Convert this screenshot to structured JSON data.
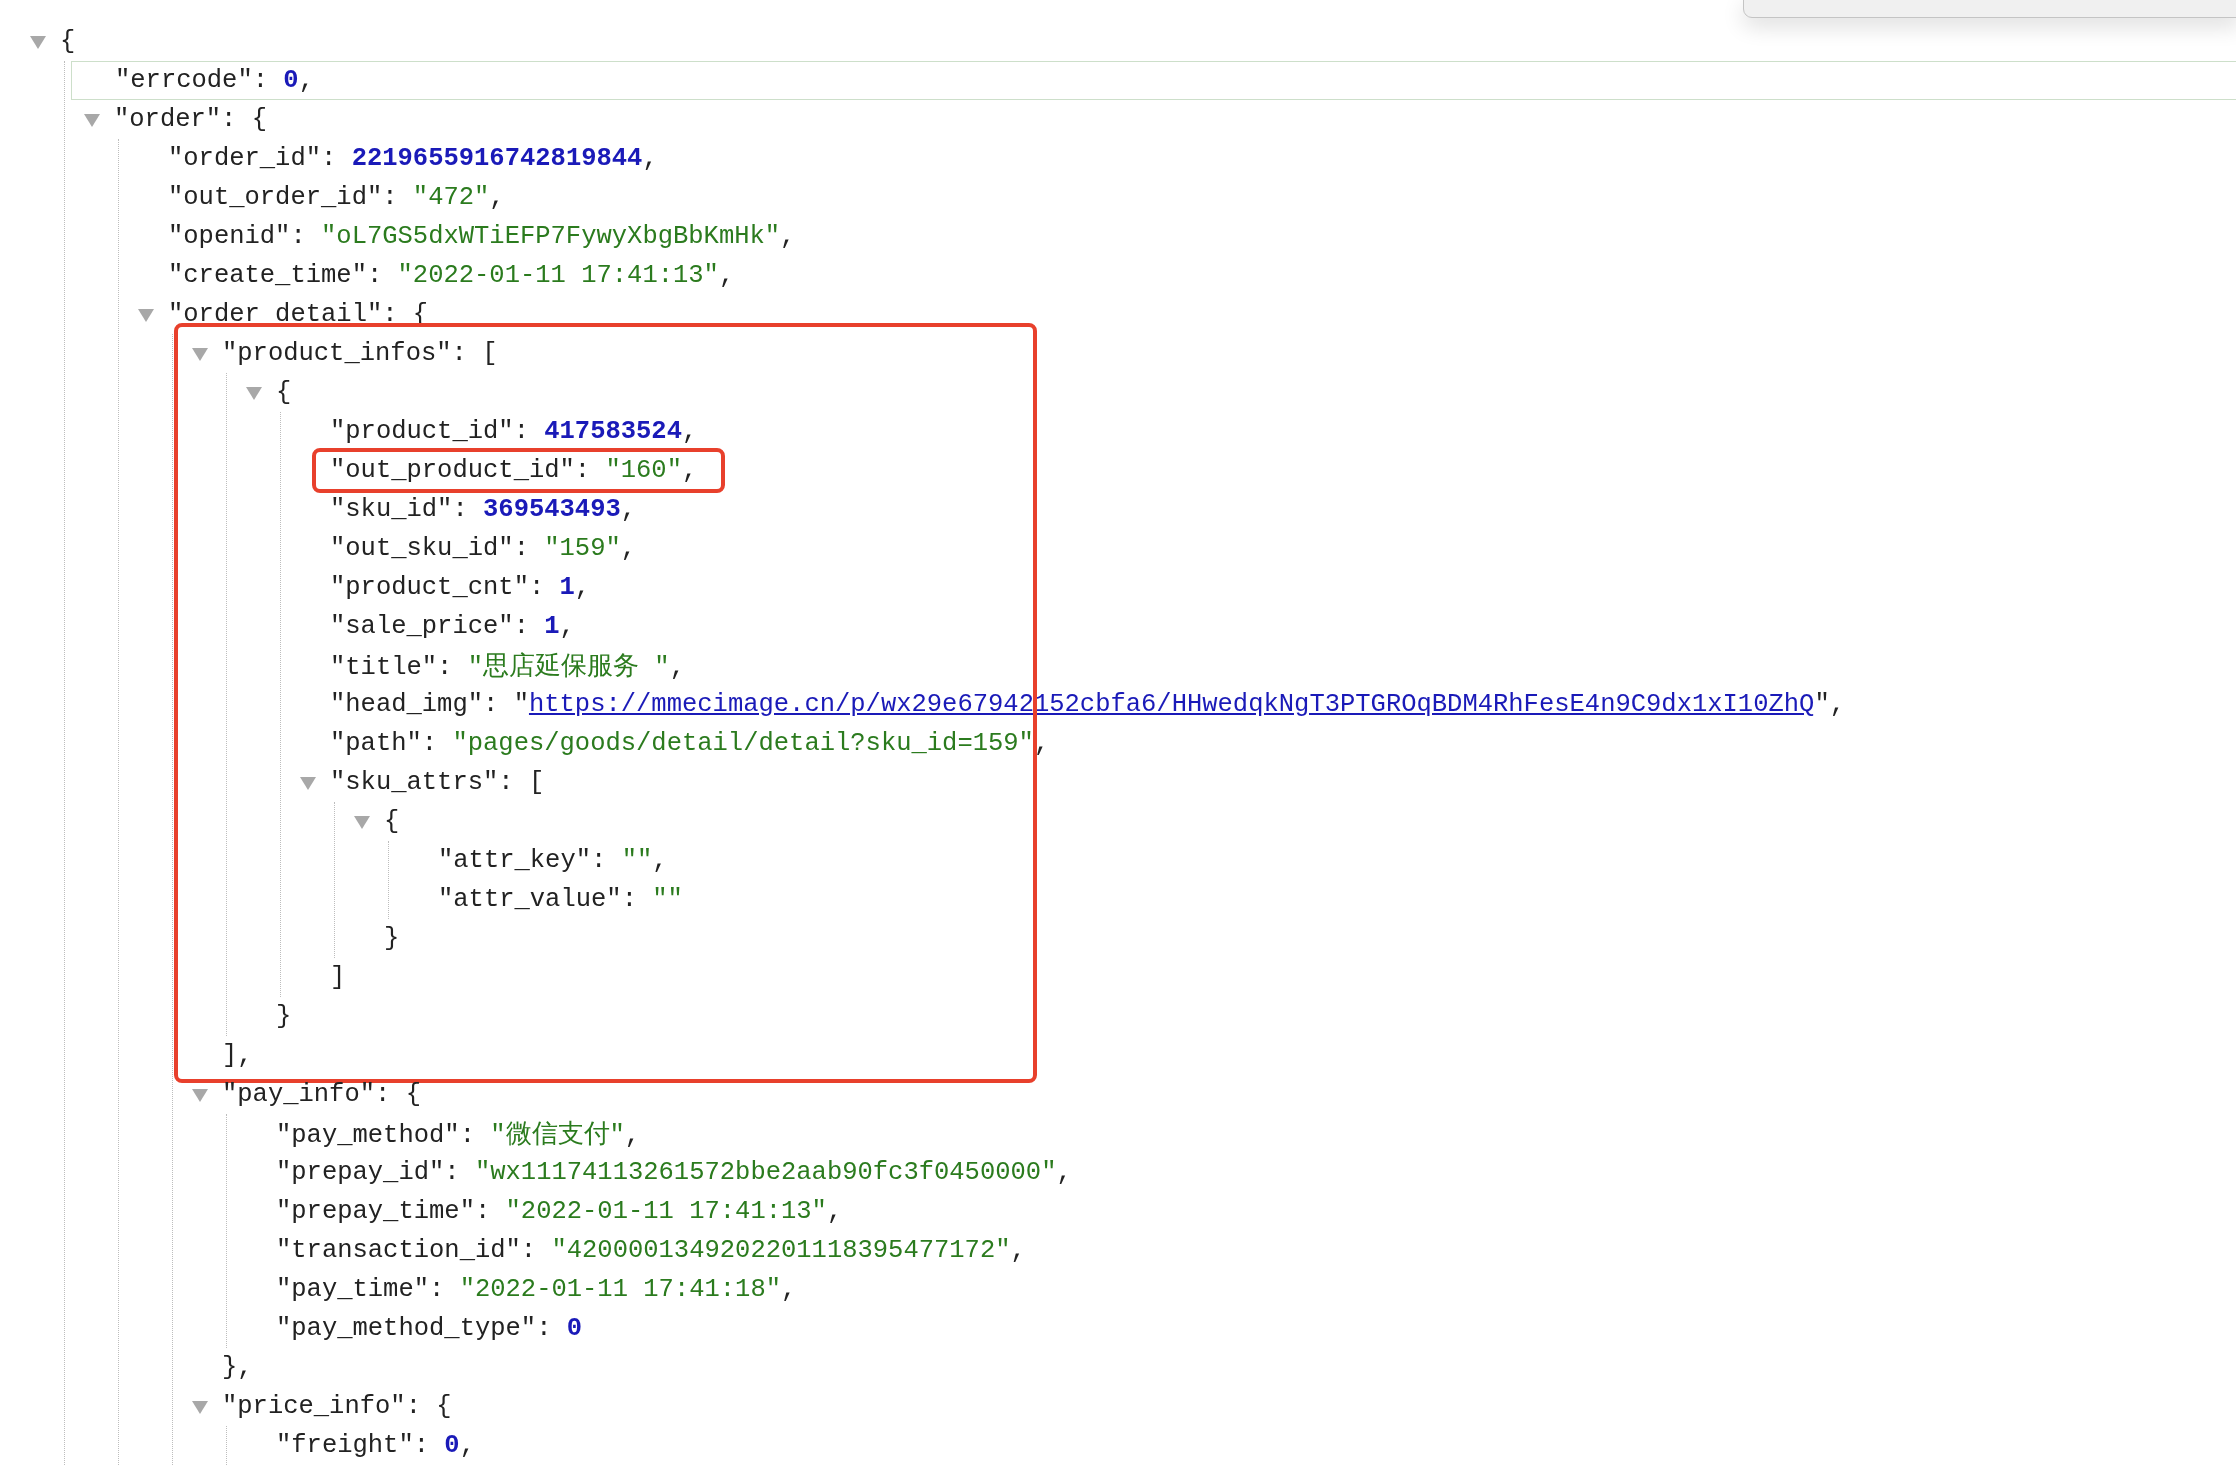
{
  "popup": {
    "visible": true
  },
  "tree": {
    "kind": "group",
    "open": "{",
    "expanded": true,
    "children": [
      {
        "kind": "number",
        "key": "\"errcode\": ",
        "value": "0",
        "tail": ",",
        "hovered": true
      },
      {
        "kind": "group",
        "key": "\"order\": ",
        "open": "{",
        "expanded": true,
        "children": [
          {
            "kind": "number",
            "key": "\"order_id\": ",
            "value": "2219655916742819844",
            "tail": ","
          },
          {
            "kind": "string",
            "key": "\"out_order_id\": ",
            "value": "\"472\"",
            "tail": ","
          },
          {
            "kind": "string",
            "key": "\"openid\": ",
            "value": "\"oL7GS5dxWTiEFP7FywyXbgBbKmHk\"",
            "tail": ","
          },
          {
            "kind": "string",
            "key": "\"create_time\": ",
            "value": "\"2022-01-11 17:41:13\"",
            "tail": ","
          },
          {
            "kind": "group",
            "key": "\"order_detail\": ",
            "open": "{",
            "expanded": true,
            "children": [
              {
                "kind": "group",
                "key": "\"product_infos\": ",
                "open": "[",
                "expanded": true,
                "highlighted": true,
                "close": "],",
                "children": [
                  {
                    "kind": "group",
                    "open": "{",
                    "expanded": true,
                    "close": "}",
                    "children": [
                      {
                        "kind": "number",
                        "key": "\"product_id\": ",
                        "value": "417583524",
                        "tail": ","
                      },
                      {
                        "kind": "string",
                        "key": "\"out_product_id\": ",
                        "value": "\"160\"",
                        "tail": ",",
                        "highlighted": true
                      },
                      {
                        "kind": "number",
                        "key": "\"sku_id\": ",
                        "value": "369543493",
                        "tail": ","
                      },
                      {
                        "kind": "string",
                        "key": "\"out_sku_id\": ",
                        "value": "\"159\"",
                        "tail": ","
                      },
                      {
                        "kind": "number",
                        "key": "\"product_cnt\": ",
                        "value": "1",
                        "tail": ","
                      },
                      {
                        "kind": "number",
                        "key": "\"sale_price\": ",
                        "value": "1",
                        "tail": ","
                      },
                      {
                        "kind": "string",
                        "key": "\"title\": ",
                        "value": "\"思店延保服务 \"",
                        "tail": ","
                      },
                      {
                        "kind": "link",
                        "key": "\"head_img\": ",
                        "lead": "\"",
                        "value": "https://mmecimage.cn/p/wx29e67942152cbfa6/HHwedqkNgT3PTGROqBDM4RhFesE4n9C9dx1xI10ZhQ",
                        "tail": "\","
                      },
                      {
                        "kind": "string",
                        "key": "\"path\": ",
                        "value": "\"pages/goods/detail/detail?sku_id=159\"",
                        "tail": ","
                      },
                      {
                        "kind": "group",
                        "key": "\"sku_attrs\": ",
                        "open": "[",
                        "expanded": true,
                        "close": "]",
                        "children": [
                          {
                            "kind": "group",
                            "open": "{",
                            "expanded": true,
                            "close": "}",
                            "children": [
                              {
                                "kind": "string",
                                "key": "\"attr_key\": ",
                                "value": "\"\"",
                                "tail": ","
                              },
                              {
                                "kind": "string",
                                "key": "\"attr_value\": ",
                                "value": "\"\""
                              }
                            ]
                          }
                        ]
                      }
                    ]
                  }
                ]
              },
              {
                "kind": "group",
                "key": "\"pay_info\": ",
                "open": "{",
                "expanded": true,
                "close": "},",
                "children": [
                  {
                    "kind": "string",
                    "key": "\"pay_method\": ",
                    "value": "\"微信支付\"",
                    "tail": ","
                  },
                  {
                    "kind": "string",
                    "key": "\"prepay_id\": ",
                    "value": "\"wx11174113261572bbe2aab90fc3f0450000\"",
                    "tail": ","
                  },
                  {
                    "kind": "string",
                    "key": "\"prepay_time\": ",
                    "value": "\"2022-01-11 17:41:13\"",
                    "tail": ","
                  },
                  {
                    "kind": "string",
                    "key": "\"transaction_id\": ",
                    "value": "\"4200001349202201118395477172\"",
                    "tail": ","
                  },
                  {
                    "kind": "string",
                    "key": "\"pay_time\": ",
                    "value": "\"2022-01-11 17:41:18\"",
                    "tail": ","
                  },
                  {
                    "kind": "number",
                    "key": "\"pay_method_type\": ",
                    "value": "0"
                  }
                ]
              },
              {
                "kind": "group",
                "key": "\"price_info\": ",
                "open": "{",
                "expanded": true,
                "children": [
                  {
                    "kind": "number",
                    "key": "\"freight\": ",
                    "value": "0",
                    "tail": ","
                  }
                ]
              }
            ]
          }
        ]
      }
    ]
  }
}
